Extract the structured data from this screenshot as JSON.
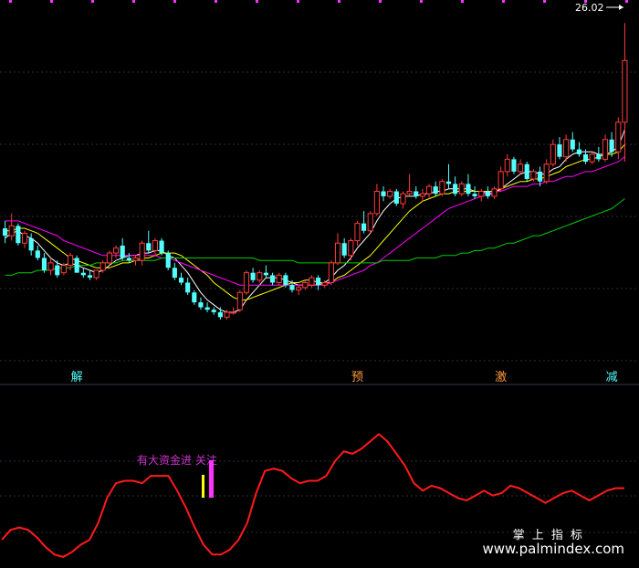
{
  "chart_data": [
    {
      "type": "candlestick",
      "price_label": "26.02",
      "colors": {
        "up": "#ff3b3b",
        "down": "#54ffff",
        "ma5": "#ffffff",
        "ma10": "#ffff00",
        "ma20": "#ff00ff",
        "ma60": "#00cc00"
      },
      "candles": [
        [
          17.7,
          18.0,
          17.1,
          17.4
        ],
        [
          17.4,
          18.3,
          17.2,
          17.8
        ],
        [
          17.8,
          17.9,
          17.0,
          17.1
        ],
        [
          17.1,
          17.6,
          16.9,
          17.5
        ],
        [
          17.3,
          17.5,
          16.6,
          16.8
        ],
        [
          16.8,
          17.0,
          16.4,
          16.5
        ],
        [
          16.5,
          16.7,
          15.9,
          16.0
        ],
        [
          16.0,
          16.5,
          15.8,
          16.3
        ],
        [
          16.2,
          16.4,
          15.7,
          15.8
        ],
        [
          15.9,
          16.3,
          15.8,
          16.2
        ],
        [
          16.2,
          16.7,
          16.0,
          16.6
        ],
        [
          16.5,
          16.6,
          15.9,
          15.9
        ],
        [
          15.9,
          16.1,
          15.7,
          15.8
        ],
        [
          15.8,
          16.0,
          15.6,
          15.7
        ],
        [
          15.7,
          16.0,
          15.6,
          16.0
        ],
        [
          16.0,
          16.4,
          15.9,
          16.3
        ],
        [
          16.3,
          16.8,
          16.2,
          16.7
        ],
        [
          16.7,
          17.0,
          16.5,
          16.9
        ],
        [
          17.0,
          17.3,
          16.4,
          16.5
        ],
        [
          16.5,
          16.7,
          16.3,
          16.4
        ],
        [
          16.4,
          16.6,
          16.2,
          16.5
        ],
        [
          16.4,
          17.2,
          16.2,
          17.1
        ],
        [
          17.1,
          17.6,
          16.7,
          16.8
        ],
        [
          16.8,
          17.3,
          16.6,
          17.2
        ],
        [
          17.2,
          17.3,
          16.6,
          16.7
        ],
        [
          16.7,
          16.8,
          16.0,
          16.1
        ],
        [
          16.1,
          16.3,
          15.6,
          15.7
        ],
        [
          15.7,
          15.9,
          15.4,
          15.5
        ],
        [
          15.5,
          15.7,
          15.0,
          15.1
        ],
        [
          15.1,
          15.2,
          14.6,
          14.7
        ],
        [
          14.7,
          14.9,
          14.4,
          14.5
        ],
        [
          14.5,
          14.7,
          14.3,
          14.4
        ],
        [
          14.4,
          14.5,
          14.2,
          14.3
        ],
        [
          14.3,
          14.5,
          14.0,
          14.1
        ],
        [
          14.1,
          14.4,
          14.0,
          14.3
        ],
        [
          14.3,
          14.5,
          14.2,
          14.3
        ],
        [
          14.4,
          15.2,
          14.3,
          15.1
        ],
        [
          15.1,
          16.0,
          15.0,
          15.9
        ],
        [
          15.9,
          16.1,
          15.5,
          15.6
        ],
        [
          15.6,
          16.0,
          15.5,
          15.9
        ],
        [
          15.9,
          16.2,
          15.7,
          15.8
        ],
        [
          15.8,
          15.9,
          15.4,
          15.5
        ],
        [
          15.5,
          15.9,
          15.4,
          15.8
        ],
        [
          15.8,
          15.9,
          15.3,
          15.4
        ],
        [
          15.4,
          15.6,
          15.1,
          15.2
        ],
        [
          15.2,
          15.4,
          15.0,
          15.3
        ],
        [
          15.3,
          15.6,
          15.2,
          15.5
        ],
        [
          15.4,
          15.8,
          15.3,
          15.7
        ],
        [
          15.7,
          15.8,
          15.2,
          15.4
        ],
        [
          15.4,
          15.6,
          15.3,
          15.5
        ],
        [
          15.5,
          16.4,
          15.4,
          16.3
        ],
        [
          16.3,
          17.5,
          16.2,
          17.1
        ],
        [
          17.1,
          17.3,
          16.5,
          16.6
        ],
        [
          16.6,
          17.3,
          16.4,
          17.2
        ],
        [
          17.2,
          18.0,
          17.0,
          17.9
        ],
        [
          17.9,
          18.4,
          17.5,
          17.6
        ],
        [
          17.6,
          18.4,
          17.5,
          18.3
        ],
        [
          18.3,
          19.5,
          18.2,
          19.2
        ],
        [
          19.2,
          19.4,
          18.8,
          19.0
        ],
        [
          19.0,
          19.3,
          18.9,
          19.2
        ],
        [
          19.2,
          19.3,
          18.6,
          18.7
        ],
        [
          18.7,
          19.2,
          18.5,
          19.1
        ],
        [
          19.1,
          19.9,
          19.0,
          19.2
        ],
        [
          19.2,
          19.4,
          18.9,
          19.0
        ],
        [
          19.0,
          19.3,
          18.8,
          19.1
        ],
        [
          19.1,
          19.5,
          18.9,
          19.4
        ],
        [
          19.4,
          19.6,
          19.0,
          19.1
        ],
        [
          19.1,
          19.7,
          19.0,
          19.6
        ],
        [
          19.6,
          20.3,
          19.3,
          19.5
        ],
        [
          19.5,
          19.8,
          19.0,
          19.1
        ],
        [
          19.1,
          19.6,
          19.0,
          19.5
        ],
        [
          19.5,
          19.9,
          19.0,
          19.1
        ],
        [
          19.1,
          19.4,
          18.9,
          19.0
        ],
        [
          19.0,
          19.3,
          18.8,
          19.2
        ],
        [
          19.2,
          19.4,
          18.9,
          19.0
        ],
        [
          19.0,
          19.4,
          18.9,
          19.3
        ],
        [
          19.3,
          20.2,
          19.2,
          20.0
        ],
        [
          20.0,
          20.7,
          19.8,
          20.5
        ],
        [
          20.5,
          20.6,
          19.9,
          20.0
        ],
        [
          20.0,
          20.5,
          19.9,
          20.3
        ],
        [
          20.3,
          20.4,
          19.6,
          19.7
        ],
        [
          19.7,
          20.1,
          19.6,
          20.0
        ],
        [
          20.0,
          20.2,
          19.4,
          19.6
        ],
        [
          19.6,
          20.5,
          19.5,
          20.3
        ],
        [
          20.3,
          21.3,
          20.2,
          21.1
        ],
        [
          21.1,
          21.4,
          20.5,
          20.6
        ],
        [
          20.6,
          21.5,
          20.4,
          21.3
        ],
        [
          21.3,
          21.6,
          20.8,
          20.9
        ],
        [
          20.9,
          21.2,
          20.6,
          20.7
        ],
        [
          20.7,
          20.9,
          20.3,
          20.4
        ],
        [
          20.4,
          20.8,
          20.3,
          20.7
        ],
        [
          20.7,
          21.0,
          20.4,
          20.5
        ],
        [
          20.5,
          21.5,
          20.4,
          21.3
        ],
        [
          21.3,
          21.6,
          20.6,
          20.8
        ],
        [
          20.8,
          22.2,
          20.5,
          22.0
        ],
        [
          22.0,
          26.02,
          20.4,
          24.5
        ]
      ],
      "ma": [
        {
          "period": 5,
          "values": [
            17.3,
            17.5,
            17.6,
            17.4,
            17.3,
            17.1,
            16.8,
            16.5,
            16.3,
            16.2,
            16.3,
            16.2,
            16.1,
            16.0,
            15.9,
            16.0,
            16.2,
            16.4,
            16.5,
            16.6,
            16.6,
            16.7,
            16.7,
            16.8,
            16.8,
            16.6,
            16.5,
            16.2,
            15.9,
            15.5,
            15.1,
            14.8,
            14.6,
            14.4,
            14.3,
            14.3,
            14.4,
            14.8,
            15.1,
            15.4,
            15.7,
            15.7,
            15.7,
            15.6,
            15.5,
            15.4,
            15.4,
            15.4,
            15.4,
            15.5,
            15.7,
            16.0,
            16.2,
            16.5,
            16.9,
            17.2,
            17.5,
            18.0,
            18.4,
            18.7,
            18.9,
            19.0,
            19.0,
            19.0,
            19.1,
            19.1,
            19.2,
            19.2,
            19.3,
            19.3,
            19.3,
            19.3,
            19.2,
            19.2,
            19.1,
            19.1,
            19.3,
            19.5,
            19.7,
            19.9,
            20.0,
            20.0,
            19.9,
            19.9,
            20.1,
            20.2,
            20.5,
            20.7,
            20.8,
            20.8,
            20.8,
            20.7,
            20.7,
            20.8,
            21.0,
            21.7
          ]
        },
        {
          "period": 10,
          "values": [
            17.6,
            17.6,
            17.7,
            17.7,
            17.6,
            17.5,
            17.3,
            17.1,
            16.9,
            16.7,
            16.5,
            16.4,
            16.3,
            16.2,
            16.1,
            16.1,
            16.1,
            16.2,
            16.3,
            16.3,
            16.4,
            16.5,
            16.5,
            16.6,
            16.7,
            16.7,
            16.7,
            16.6,
            16.4,
            16.2,
            16.0,
            15.8,
            15.5,
            15.3,
            15.1,
            14.9,
            14.8,
            14.8,
            14.9,
            15.0,
            15.1,
            15.2,
            15.3,
            15.4,
            15.5,
            15.5,
            15.6,
            15.6,
            15.5,
            15.5,
            15.5,
            15.7,
            15.8,
            16.0,
            16.2,
            16.4,
            16.6,
            16.9,
            17.2,
            17.5,
            17.8,
            18.1,
            18.4,
            18.6,
            18.8,
            18.9,
            19.0,
            19.1,
            19.1,
            19.2,
            19.2,
            19.2,
            19.2,
            19.2,
            19.2,
            19.2,
            19.3,
            19.4,
            19.5,
            19.6,
            19.6,
            19.7,
            19.7,
            19.8,
            19.9,
            20.0,
            20.2,
            20.3,
            20.4,
            20.5,
            20.5,
            20.6,
            20.7,
            20.7,
            20.8,
            21.1
          ]
        },
        {
          "period": 20,
          "values": [
            18.0,
            18.0,
            18.0,
            17.9,
            17.8,
            17.7,
            17.6,
            17.5,
            17.4,
            17.2,
            17.1,
            17.0,
            16.9,
            16.8,
            16.7,
            16.6,
            16.6,
            16.6,
            16.6,
            16.6,
            16.6,
            16.6,
            16.6,
            16.6,
            16.5,
            16.5,
            16.4,
            16.3,
            16.2,
            16.1,
            16.0,
            15.9,
            15.8,
            15.7,
            15.6,
            15.5,
            15.4,
            15.4,
            15.4,
            15.4,
            15.4,
            15.4,
            15.4,
            15.4,
            15.4,
            15.4,
            15.4,
            15.4,
            15.4,
            15.4,
            15.5,
            15.6,
            15.7,
            15.8,
            15.9,
            16.0,
            16.2,
            16.3,
            16.5,
            16.7,
            16.9,
            17.1,
            17.3,
            17.5,
            17.7,
            17.9,
            18.1,
            18.3,
            18.5,
            18.6,
            18.7,
            18.8,
            18.9,
            19.0,
            19.1,
            19.2,
            19.2,
            19.3,
            19.4,
            19.4,
            19.4,
            19.5,
            19.5,
            19.6,
            19.6,
            19.7,
            19.8,
            19.8,
            19.9,
            20.0,
            20.0,
            20.1,
            20.2,
            20.3,
            20.4,
            20.6
          ]
        },
        {
          "period": 60,
          "values": [
            15.8,
            15.8,
            15.9,
            15.9,
            15.9,
            16.0,
            16.0,
            16.0,
            16.1,
            16.1,
            16.1,
            16.2,
            16.2,
            16.2,
            16.3,
            16.3,
            16.3,
            16.3,
            16.4,
            16.4,
            16.4,
            16.4,
            16.4,
            16.4,
            16.5,
            16.5,
            16.5,
            16.5,
            16.5,
            16.5,
            16.5,
            16.5,
            16.5,
            16.5,
            16.5,
            16.5,
            16.5,
            16.5,
            16.5,
            16.4,
            16.4,
            16.4,
            16.4,
            16.4,
            16.4,
            16.3,
            16.3,
            16.3,
            16.3,
            16.3,
            16.3,
            16.3,
            16.3,
            16.3,
            16.3,
            16.3,
            16.3,
            16.3,
            16.4,
            16.4,
            16.4,
            16.4,
            16.4,
            16.5,
            16.5,
            16.5,
            16.5,
            16.6,
            16.6,
            16.6,
            16.7,
            16.7,
            16.8,
            16.8,
            16.9,
            16.9,
            17.0,
            17.1,
            17.1,
            17.2,
            17.3,
            17.4,
            17.4,
            17.5,
            17.6,
            17.7,
            17.8,
            17.9,
            18.0,
            18.1,
            18.2,
            18.3,
            18.4,
            18.5,
            18.7,
            18.9
          ]
        }
      ],
      "signals": [
        {
          "label": "解",
          "index": 11,
          "color": "#54ffff"
        },
        {
          "label": "预",
          "index": 54,
          "color": "#ff9a3c"
        },
        {
          "label": "激",
          "index": 76,
          "color": "#ff9a3c"
        },
        {
          "label": "减",
          "index": 93,
          "color": "#54ffff"
        }
      ]
    },
    {
      "type": "line",
      "series": [
        {
          "color": "#ff1a1a",
          "values": [
            10,
            14,
            15,
            14,
            11,
            7,
            4,
            3,
            5,
            8,
            10,
            17,
            27,
            33,
            34,
            34,
            33,
            36,
            36,
            36,
            30,
            23,
            15,
            8,
            4,
            4,
            6,
            10,
            17,
            29,
            38,
            39,
            38,
            35,
            33,
            34,
            34,
            36,
            42,
            46,
            45,
            47,
            50,
            53,
            50,
            45,
            40,
            33,
            30,
            32,
            31,
            29,
            27,
            26,
            28,
            30,
            28,
            29,
            32,
            31,
            29,
            27,
            25,
            27,
            29,
            30,
            28,
            26,
            28,
            30,
            31,
            31
          ]
        }
      ],
      "annotation_text": "有大资金进 关注",
      "annotation_colors": {
        "text": "#cc33cc",
        "bar1": "#ffff00",
        "bar2": "#ff33ff"
      }
    }
  ],
  "watermark": {
    "line1": "掌 上 指 标",
    "line2": "www.palmindex.com"
  }
}
